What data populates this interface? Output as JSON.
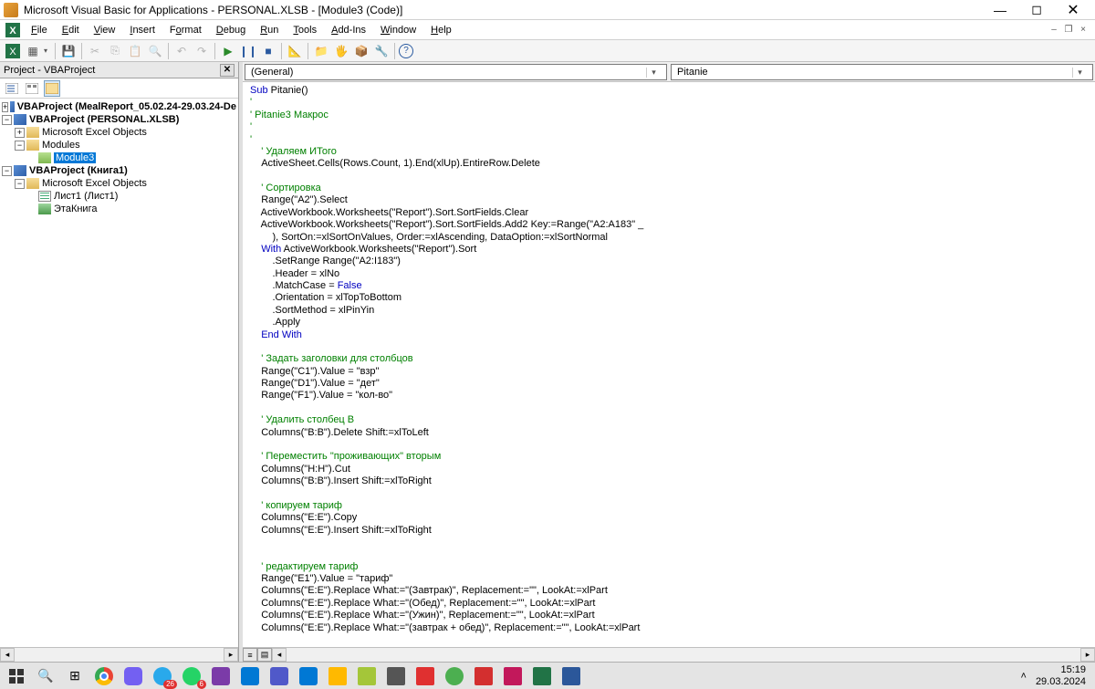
{
  "window": {
    "title": "Microsoft Visual Basic for Applications - PERSONAL.XLSB - [Module3 (Code)]"
  },
  "menu": {
    "file": "File",
    "edit": "Edit",
    "view": "View",
    "insert": "Insert",
    "format": "Format",
    "debug": "Debug",
    "run": "Run",
    "tools": "Tools",
    "addins": "Add-Ins",
    "window": "Window",
    "help": "Help"
  },
  "project_panel": {
    "title": "Project - VBAProject",
    "tree": {
      "proj1": "VBAProject (MealReport_05.02.24-29.03.24-De",
      "proj2": "VBAProject (PERSONAL.XLSB)",
      "proj2_folder1": "Microsoft Excel Objects",
      "proj2_folder2": "Modules",
      "proj2_module": "Module3",
      "proj3": "VBAProject (Книга1)",
      "proj3_folder1": "Microsoft Excel Objects",
      "proj3_sheet": "Лист1 (Лист1)",
      "proj3_book": "ЭтаКнига"
    }
  },
  "code_dropdowns": {
    "left": "(General)",
    "right": "Pitanie"
  },
  "code": {
    "l1_a": "Sub",
    "l1_b": " Pitanie()",
    "l2": "'",
    "l3": "' Pitanie3 Макрос",
    "l4": "'",
    "l5": "'",
    "l6": "    ' Удаляем ИТого",
    "l7": "    ActiveSheet.Cells(Rows.Count, 1).End(xlUp).EntireRow.Delete",
    "l8": "",
    "l9": "    ' Сортировка",
    "l10": "    Range(\"A2\").Select",
    "l11": "    ActiveWorkbook.Worksheets(\"Report\").Sort.SortFields.Clear",
    "l12": "    ActiveWorkbook.Worksheets(\"Report\").Sort.SortFields.Add2 Key:=Range(\"A2:A183\" _",
    "l13": "        ), SortOn:=xlSortOnValues, Order:=xlAscending, DataOption:=xlSortNormal",
    "l14_a": "    ",
    "l14_b": "With",
    "l14_c": " ActiveWorkbook.Worksheets(\"Report\").Sort",
    "l15": "        .SetRange Range(\"A2:I183\")",
    "l16": "        .Header = xlNo",
    "l17_a": "        .MatchCase = ",
    "l17_b": "False",
    "l18": "        .Orientation = xlTopToBottom",
    "l19": "        .SortMethod = xlPinYin",
    "l20": "        .Apply",
    "l21": "    End With",
    "l22": "",
    "l23": "    ' Задать заголовки для столбцов",
    "l24": "    Range(\"C1\").Value = \"взр\"",
    "l25": "    Range(\"D1\").Value = \"дет\"",
    "l26": "    Range(\"F1\").Value = \"кол-во\"",
    "l27": "",
    "l28": "    ' Удалить столбец B",
    "l29": "    Columns(\"B:B\").Delete Shift:=xlToLeft",
    "l30": "",
    "l31": "    ' Переместить \"проживающих\" вторым",
    "l32": "    Columns(\"H:H\").Cut",
    "l33": "    Columns(\"B:B\").Insert Shift:=xlToRight",
    "l34": "",
    "l35": "    ' копируем тариф",
    "l36": "    Columns(\"E:E\").Copy",
    "l37": "    Columns(\"E:E\").Insert Shift:=xlToRight",
    "l38": "",
    "l39": "",
    "l40": "    ' редактируем тариф",
    "l41": "    Range(\"E1\").Value = \"тариф\"",
    "l42": "    Columns(\"E:E\").Replace What:=\"(Завтрак)\", Replacement:=\"\", LookAt:=xlPart",
    "l43": "    Columns(\"E:E\").Replace What:=\"(Обед)\", Replacement:=\"\", LookAt:=xlPart",
    "l44": "    Columns(\"E:E\").Replace What:=\"(Ужин)\", Replacement:=\"\", LookAt:=xlPart",
    "l45": "    Columns(\"E:E\").Replace What:=\"(завтрак + обед)\", Replacement:=\"\", LookAt:=xlPart"
  },
  "taskbar": {
    "telegram_badge": "26",
    "whatsapp_badge": "6",
    "time": "15:19",
    "date": "29.03.2024"
  }
}
